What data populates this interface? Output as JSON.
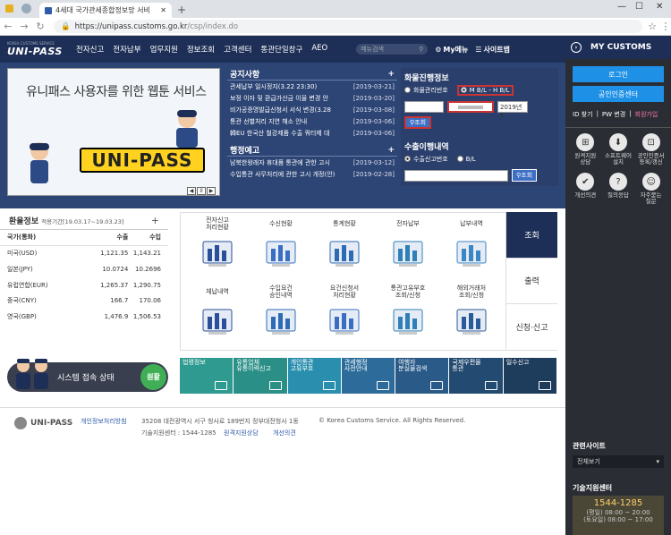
{
  "browser": {
    "tab_title": "4세대 국가관세종합정보망 서비",
    "url_domain": "https://unipass.customs.go.kr",
    "url_path": "/csp/index.do",
    "new_tab": "+",
    "win_min": "—",
    "win_max": "☐",
    "win_close": "✕"
  },
  "header": {
    "logo_small": "KOREA CUSTOMS SERVICE",
    "logo": "UNI-PASS",
    "menu": [
      "전자신고",
      "전자납부",
      "업무지원",
      "정보조회",
      "고객센터",
      "통관단일창구",
      "AEO"
    ],
    "search_placeholder": "메뉴검색",
    "my_menu": "My메뉴",
    "sitemap": "사이트맵"
  },
  "banner": {
    "title": "유니패스 사용자를 위한 웹툰 서비스",
    "unipass": "UNI-PASS",
    "page": "II"
  },
  "notice": {
    "title": "공지사항",
    "items": [
      {
        "t": "관세납부 일시정지(3.22 23:30)",
        "d": "[2019-03-21]"
      },
      {
        "t": "보정 이자 및 환급가산금 이율 변경 안",
        "d": "[2019-03-20]"
      },
      {
        "t": "비가공증명발급신청서 서식 변경(3.28",
        "d": "[2019-03-08]"
      },
      {
        "t": "통관 선별처리 지연 해소 안내",
        "d": "[2019-03-06]"
      },
      {
        "t": "韓EU 한국산 철강제품 수출 쿼터제 대",
        "d": "[2019-03-06]"
      }
    ]
  },
  "admin": {
    "title": "행정예고",
    "items": [
      {
        "t": "남북한왕래자 휴대품 통관에 관한 고시",
        "d": "[2019-03-12]"
      },
      {
        "t": "수입통관 사무처리에 관한 고시 개정(안)",
        "d": "[2019-02-28]"
      }
    ]
  },
  "cargo": {
    "title": "화물진행정보",
    "opt1": "화물관리번호",
    "opt2": "M B/L - H B/L",
    "year": "2019년",
    "search": "조회"
  },
  "export": {
    "title": "수출이행내역",
    "opt1": "수출신고번호",
    "opt2": "B/L",
    "search": "조회"
  },
  "currency": {
    "title": "환율정보",
    "period": "적용기간[19.03.17~19.03.23]",
    "h1": "국가(통화)",
    "h2": "수출",
    "h3": "수입",
    "rows": [
      [
        "미국(USD)",
        "1,121.35",
        "1,143.21"
      ],
      [
        "일본(JPY)",
        "10.0724",
        "10.2696"
      ],
      [
        "유럽연합(EUR)",
        "1,265.37",
        "1,290.75"
      ],
      [
        "중국(CNY)",
        "166.7",
        "170.06"
      ],
      [
        "영국(GBP)",
        "1,476.9",
        "1,506.53"
      ]
    ]
  },
  "services": [
    "전자신고\n처리현황",
    "수신현황",
    "통계현황",
    "전자납부",
    "납부내역",
    "체납내역",
    "수입요건\n승인내역",
    "요건신청서\n처리현황",
    "통관고유부호\n조회/신청",
    "해외거래처\n조회/신청"
  ],
  "sidetabs": [
    "조회",
    "출력",
    "신청·신고"
  ],
  "status": {
    "label": "시스템 접속 상태",
    "value": "원활"
  },
  "quick": [
    {
      "t": "법령정보",
      "c": "#2f9a8f"
    },
    {
      "t": "유통업체\n유통이력신고",
      "c": "#2a8f86"
    },
    {
      "t": "개인통관\n고유부호",
      "c": "#2a8fae"
    },
    {
      "t": "관세행정\n사전안내",
      "c": "#2d6c9a"
    },
    {
      "t": "여행자\n분실물검색",
      "c": "#2a5a88"
    },
    {
      "t": "국제우편물\n통관",
      "c": "#234a70"
    },
    {
      "t": "일수신고",
      "c": "#1e3c5c"
    }
  ],
  "footer": {
    "logo": "UNI-PASS",
    "privacy": "개인정보처리방침",
    "address": "35208 대전광역시 서구 청사로 189번지 정부대전청사 1동",
    "copyright": "© Korea Customs Service. All Rights Reserved.",
    "center": "기술지원센터 : 1544-1285",
    "remote": "원격지원상담",
    "opinion": "개선의견"
  },
  "right": {
    "title": "MY CUSTOMS",
    "login": "로그인",
    "cert": "공인인증센터",
    "id": "ID 찾기",
    "pw": "PW 변경",
    "join": "회원가입",
    "grid": [
      "원격지원\n상담",
      "소프트웨어\n설치",
      "공인인증서\n등록/갱신",
      "개선의견",
      "질의응답",
      "자주묻는\n질문"
    ],
    "related": "관련사이트",
    "related_sel": "전체보기",
    "support": "기술지원센터",
    "phone": "1544-1285",
    "hour1": "(평일) 08:00 ~ 20:00",
    "hour2": "(토요일) 08:00 ~ 17:00"
  }
}
